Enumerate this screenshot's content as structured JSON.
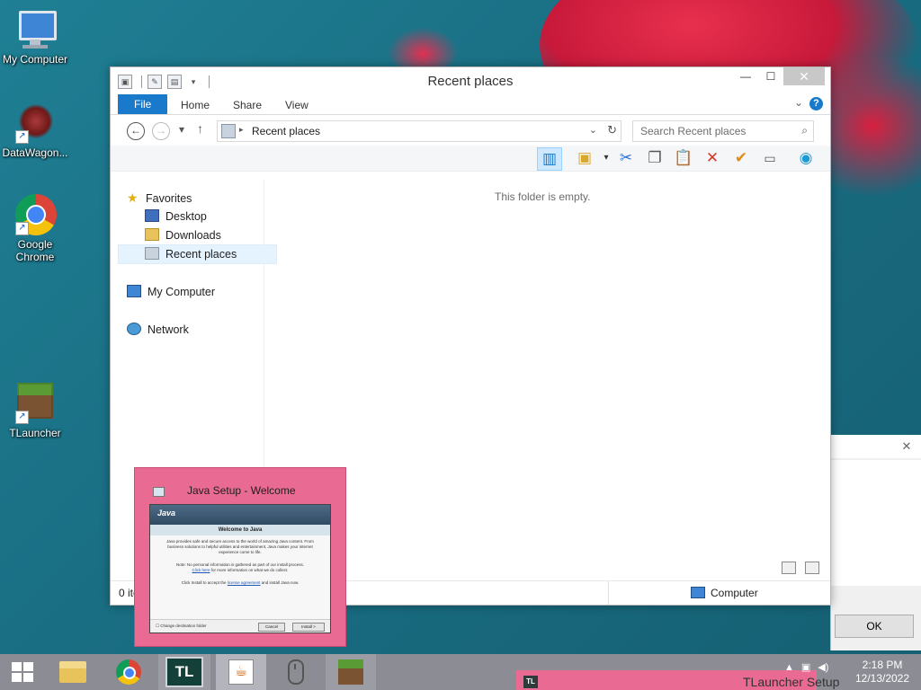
{
  "desktop": {
    "icons": [
      {
        "label": "My Computer"
      },
      {
        "label": "DataWagon..."
      },
      {
        "label": "Google Chrome"
      },
      {
        "label": "TLauncher"
      }
    ]
  },
  "explorer": {
    "title": "Recent places",
    "ribbon_tabs": [
      "File",
      "Home",
      "Share",
      "View"
    ],
    "address": "Recent places",
    "search_placeholder": "Search Recent places",
    "empty_message": "This folder is empty.",
    "sidebar": {
      "favorites": "Favorites",
      "desktop": "Desktop",
      "downloads": "Downloads",
      "recent": "Recent places",
      "computer": "My Computer",
      "network": "Network"
    },
    "status_count": "0 items",
    "status_location": "Computer"
  },
  "background_dialog": {
    "close": "✕",
    "ok": "OK"
  },
  "java_thumbnail": {
    "title": "Java Setup - Welcome",
    "logo": "Java",
    "heading": "Welcome to Java",
    "para1": "Java provides safe and secure access to the world of amazing Java content. From business solutions to helpful utilities and entertainment, Java makes your internet experience come to life.",
    "para2_pre": "Note: No personal information is gathered as part of our install process.",
    "para2_link": "Click here",
    "para2_post": "for more information on what we do collect.",
    "para3_pre": "Click Install to accept the",
    "para3_link": "license agreement",
    "para3_post": "and install Java now.",
    "checkbox": "Change destination folder",
    "cancel": "Cancel",
    "install": "Install >"
  },
  "taskbar": {
    "tl_label": "TL",
    "tlauncher_setup": "TLauncher Setup",
    "setup_icon": "TL",
    "time": "2:18 PM",
    "date": "12/13/2022"
  }
}
